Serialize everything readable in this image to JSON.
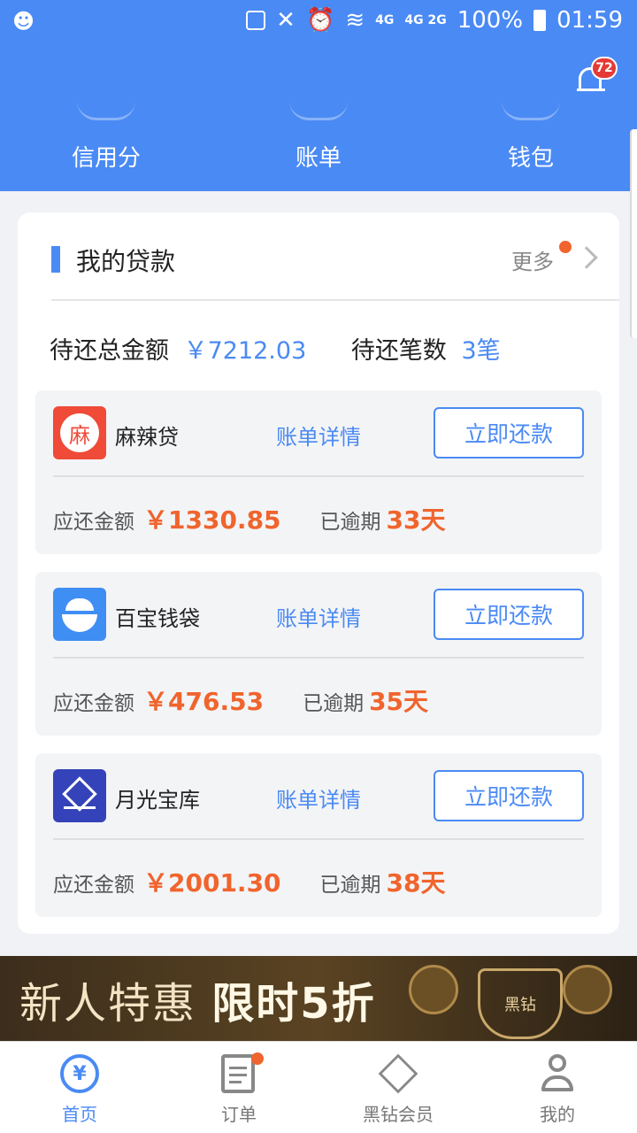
{
  "status_bar": {
    "network": "4G",
    "network2": "4G 2G",
    "battery": "100%",
    "time": "01:59"
  },
  "header": {
    "notification_count": "72",
    "items": [
      "信用分",
      "账单",
      "钱包"
    ]
  },
  "loans_section": {
    "title": "我的贷款",
    "more_label": "更多",
    "summary": {
      "total_label": "待还总金额",
      "total_value": "￥7212.03",
      "count_label": "待还笔数",
      "count_value": "3笔"
    },
    "loans": [
      {
        "name": "麻辣贷",
        "logo_icon": "malaidai-logo-icon",
        "logo_text": "麻",
        "logo_color": "#f04a38",
        "detail_label": "账单详情",
        "repay_label": "立即还款",
        "amount_label": "应还金额",
        "amount": "￥1330.85",
        "overdue_label": "已逾期",
        "overdue_days": "33天"
      },
      {
        "name": "百宝钱袋",
        "logo_icon": "baibao-logo-icon",
        "logo_text": "",
        "logo_color": "#3f8ef3",
        "detail_label": "账单详情",
        "repay_label": "立即还款",
        "amount_label": "应还金额",
        "amount": "￥476.53",
        "overdue_label": "已逾期",
        "overdue_days": "35天"
      },
      {
        "name": "月光宝库",
        "logo_icon": "yueguang-logo-icon",
        "logo_text": "",
        "logo_color": "#3443b9",
        "detail_label": "账单详情",
        "repay_label": "立即还款",
        "amount_label": "应还金额",
        "amount": "￥2001.30",
        "overdue_label": "已逾期",
        "overdue_days": "38天"
      }
    ]
  },
  "banner": {
    "text_plain": "新人特惠",
    "text_bold": "限时5折",
    "badge_text": "黑钻"
  },
  "tabbar": {
    "items": [
      {
        "label": "首页",
        "icon": "yen-circle-icon",
        "active": true
      },
      {
        "label": "订单",
        "icon": "order-doc-icon",
        "active": false
      },
      {
        "label": "黑钻会员",
        "icon": "diamond-icon",
        "active": false
      },
      {
        "label": "我的",
        "icon": "user-icon",
        "active": false
      }
    ]
  },
  "colors": {
    "primary": "#4a8af4",
    "accent": "#f0642d"
  }
}
